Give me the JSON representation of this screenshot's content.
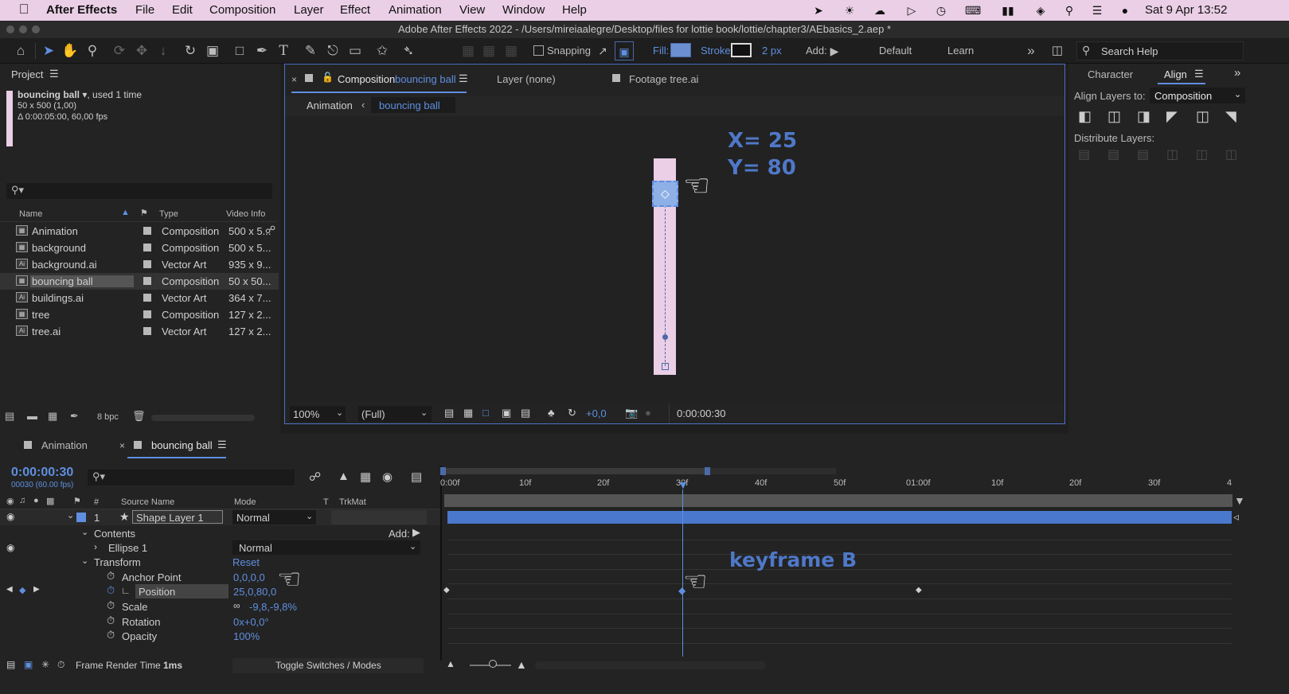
{
  "menubar": {
    "app_name": "After Effects",
    "items": [
      "File",
      "Edit",
      "Composition",
      "Layer",
      "Effect",
      "Animation",
      "View",
      "Window",
      "Help"
    ],
    "clock": "Sat 9 Apr  13:52"
  },
  "window": {
    "title": "Adobe After Effects 2022 - /Users/mireiaalegre/Desktop/files for lottie book/lottie/chapter3/AEbasics_2.aep *"
  },
  "toolbar": {
    "snapping_label": "Snapping",
    "fill_label": "Fill:",
    "stroke_label": "Stroke:",
    "stroke_width": "2 px",
    "add_label": "Add:",
    "workspace_default": "Default",
    "workspace_learn": "Learn",
    "search_help_placeholder": "Search Help",
    "fill_color": "#6b8fd0"
  },
  "project": {
    "title": "Project",
    "selected_name": "bouncing ball",
    "selected_usage": ", used 1 time",
    "selected_dims": "50 x 500 (1,00)",
    "selected_duration": "Δ 0:00:05:00, 60,00 fps",
    "columns": {
      "name": "Name",
      "type": "Type",
      "video_info": "Video Info"
    },
    "bpc": "8 bpc",
    "items": [
      {
        "name": "Animation",
        "type": "Composition",
        "info": "500 x 5...",
        "kind": "comp"
      },
      {
        "name": "background",
        "type": "Composition",
        "info": "500 x 5...",
        "kind": "comp"
      },
      {
        "name": "background.ai",
        "type": "Vector Art",
        "info": "935 x 9...",
        "kind": "ai"
      },
      {
        "name": "bouncing ball",
        "type": "Composition",
        "info": "50 x 50...",
        "kind": "comp"
      },
      {
        "name": "buildings.ai",
        "type": "Vector Art",
        "info": "364 x 7...",
        "kind": "ai"
      },
      {
        "name": "tree",
        "type": "Composition",
        "info": "127 x 2...",
        "kind": "comp"
      },
      {
        "name": "tree.ai",
        "type": "Vector Art",
        "info": "127 x 2...",
        "kind": "ai"
      }
    ]
  },
  "composition": {
    "tab_prefix": "Composition",
    "tab_name": "bouncing ball",
    "layer_tab": "Layer (none)",
    "footage_tab": "Footage tree.ai",
    "breadcrumb_parent": "Animation",
    "breadcrumb_current": "bouncing ball",
    "zoom": "100%",
    "resolution": "(Full)",
    "exposure": "+0,0",
    "timecode": "0:00:00:30",
    "annotation_x": "X= 25",
    "annotation_y": "Y= 80"
  },
  "right_panel": {
    "tab_character": "Character",
    "tab_align": "Align",
    "align_layers_to_label": "Align Layers to:",
    "align_layers_to_value": "Composition",
    "distribute_label": "Distribute Layers:"
  },
  "timeline": {
    "tab_animation": "Animation",
    "tab_bouncing": "bouncing ball",
    "current_time": "0:00:00:30",
    "frame_info": "00030 (60.00 fps)",
    "ruler_labels": [
      "0:00f",
      "10f",
      "20f",
      "30f",
      "40f",
      "50f",
      "01:00f",
      "10f",
      "20f",
      "30f",
      "4"
    ],
    "columns": {
      "num": "#",
      "source": "Source Name",
      "mode": "Mode",
      "t": "T",
      "trkmat": "TrkMat"
    },
    "layer": {
      "index": "1",
      "name": "Shape Layer 1",
      "mode": "Normal"
    },
    "contents_label": "Contents",
    "add_label": "Add:",
    "ellipse_label": "Ellipse 1",
    "ellipse_mode": "Normal",
    "transform_label": "Transform",
    "reset_label": "Reset",
    "props": [
      {
        "name": "Anchor Point",
        "value": "0,0,0,0"
      },
      {
        "name": "Position",
        "value": "25,0,80,0"
      },
      {
        "name": "Scale",
        "value": "-9,8,-9,8%"
      },
      {
        "name": "Rotation",
        "value": "0x+0,0°"
      },
      {
        "name": "Opacity",
        "value": "100%"
      }
    ],
    "annotation_keyframe": "keyframe B",
    "frame_render_label": "Frame Render Time",
    "frame_render_value": "1ms",
    "toggle_label": "Toggle Switches / Modes"
  }
}
